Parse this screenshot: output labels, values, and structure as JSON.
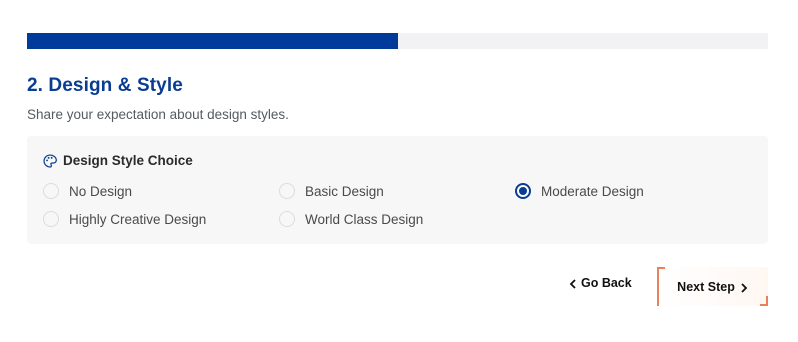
{
  "progress": {
    "percent": 50
  },
  "step": {
    "title": "2. Design & Style",
    "subtitle": "Share your expectation about design styles."
  },
  "design_choice": {
    "icon": "palette-icon",
    "label": "Design Style Choice",
    "selected": "Moderate Design",
    "options": [
      {
        "label": "No Design",
        "checked": false
      },
      {
        "label": "Basic Design",
        "checked": false
      },
      {
        "label": "Moderate Design",
        "checked": true
      },
      {
        "label": "Highly Creative Design",
        "checked": false
      },
      {
        "label": "World Class Design",
        "checked": false
      }
    ]
  },
  "navigation": {
    "back_label": "Go Back",
    "next_label": "Next Step"
  },
  "colors": {
    "accent": "#0a3d91",
    "progress_fill": "#003b9b",
    "next_border": "#e8815a"
  }
}
